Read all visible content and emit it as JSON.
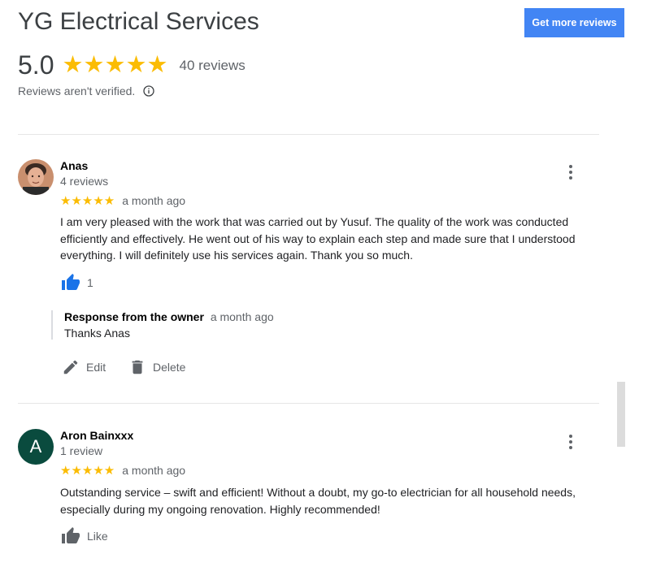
{
  "header": {
    "title": "YG Electrical Services",
    "get_more_label": "Get more reviews"
  },
  "summary": {
    "rating": "5.0",
    "stars": "★★★★★",
    "count": "40 reviews",
    "not_verified": "Reviews aren't verified."
  },
  "reviews": [
    {
      "name": "Anas",
      "review_count": "4 reviews",
      "stars": "★★★★★",
      "date": "a month ago",
      "text": "I am very pleased with the work that was carried out by Yusuf. The quality of the work was conducted efficiently and effectively. He went out of his way to explain each step and made sure that I understood everything. I will definitely use his services again. Thank you so much.",
      "likes": "1",
      "owner_response": {
        "label": "Response from the owner",
        "date": "a month ago",
        "text": "Thanks Anas"
      },
      "actions": {
        "edit": "Edit",
        "delete": "Delete"
      }
    },
    {
      "name": "Aron Bainxxx",
      "avatar_letter": "A",
      "review_count": "1 review",
      "stars": "★★★★★",
      "date": "a month ago",
      "text": "Outstanding service – swift and efficient! Without a doubt, my go-to electrician for all household needs, especially during my ongoing renovation. Highly recommended!",
      "like_label": "Like"
    }
  ],
  "colors": {
    "accent": "#4285f4",
    "star": "#fbbc04",
    "like_active": "#1a73e8",
    "avatar_bg": "#0a4b3e"
  }
}
